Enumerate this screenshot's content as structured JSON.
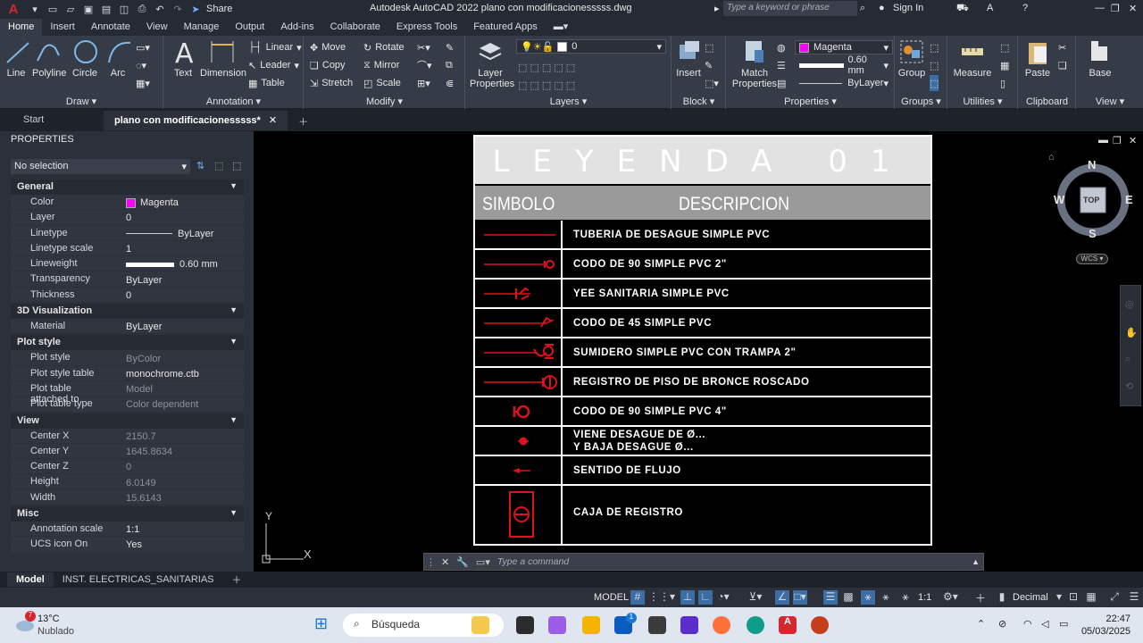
{
  "titlebar": {
    "title": "Autodesk AutoCAD 2022    plano con modificacionesssss.dwg",
    "share": "Share",
    "search_placeholder": "Type a keyword or phrase",
    "sign_in": "Sign In"
  },
  "ribbon_tabs": [
    "Home",
    "Insert",
    "Annotate",
    "View",
    "Manage",
    "Output",
    "Add-ins",
    "Collaborate",
    "Express Tools",
    "Featured Apps"
  ],
  "ribbon": {
    "draw": {
      "title": "Draw ▾",
      "line": "Line",
      "polyline": "Polyline",
      "circle": "Circle",
      "arc": "Arc"
    },
    "annotation": {
      "title": "Annotation ▾",
      "text": "Text",
      "dimension": "Dimension",
      "linear": "Linear",
      "leader": "Leader",
      "table": "Table"
    },
    "modify": {
      "title": "Modify ▾",
      "move": "Move",
      "rotate": "Rotate",
      "copy": "Copy",
      "mirror": "Mirror",
      "stretch": "Stretch",
      "scale": "Scale"
    },
    "layers": {
      "title": "Layers ▾",
      "layer_properties_1": "Layer",
      "layer_properties_2": "Properties",
      "layer_value": "0"
    },
    "block": {
      "title": "Block ▾",
      "insert": "Insert"
    },
    "properties": {
      "title": "Properties ▾",
      "match_1": "Match",
      "match_2": "Properties",
      "color": "Magenta",
      "lineweight": "0.60 mm",
      "linetype": "ByLayer"
    },
    "groups": {
      "title": "Groups ▾",
      "group": "Group"
    },
    "utilities": {
      "title": "Utilities ▾",
      "measure": "Measure"
    },
    "clipboard": {
      "title": "Clipboard",
      "paste": "Paste"
    },
    "view": {
      "title": "View ▾",
      "base": "Base"
    }
  },
  "doc_tabs": {
    "start": "Start",
    "active": "plano con modificacionesssss*"
  },
  "properties_palette": {
    "header": "PROPERTIES",
    "selection": "No selection",
    "sections": {
      "general": "General",
      "viz": "3D Visualization",
      "plot": "Plot style",
      "view": "View",
      "misc": "Misc"
    },
    "general": [
      {
        "k": "Color",
        "v": "Magenta"
      },
      {
        "k": "Layer",
        "v": "0"
      },
      {
        "k": "Linetype",
        "v": "ByLayer"
      },
      {
        "k": "Linetype scale",
        "v": "1"
      },
      {
        "k": "Lineweight",
        "v": "0.60 mm"
      },
      {
        "k": "Transparency",
        "v": "ByLayer"
      },
      {
        "k": "Thickness",
        "v": "0"
      }
    ],
    "viz": [
      {
        "k": "Material",
        "v": "ByLayer"
      }
    ],
    "plot": [
      {
        "k": "Plot style",
        "v": "ByColor"
      },
      {
        "k": "Plot style table",
        "v": "monochrome.ctb"
      },
      {
        "k": "Plot table attached to",
        "v": "Model"
      },
      {
        "k": "Plot table type",
        "v": "Color dependent"
      }
    ],
    "view": [
      {
        "k": "Center X",
        "v": "2150.7"
      },
      {
        "k": "Center Y",
        "v": "1645.8634"
      },
      {
        "k": "Center Z",
        "v": "0"
      },
      {
        "k": "Height",
        "v": "6.0149"
      },
      {
        "k": "Width",
        "v": "15.6143"
      }
    ],
    "misc": [
      {
        "k": "Annotation scale",
        "v": "1:1"
      },
      {
        "k": "UCS icon On",
        "v": "Yes"
      }
    ]
  },
  "legend": {
    "title": "LEYENDA 01",
    "col_symbol": "SIMBOLO",
    "col_desc": "DESCRIPCION",
    "rows": [
      "TUBERIA DE DESAGUE SIMPLE PVC",
      "CODO DE 90 SIMPLE PVC 2\"",
      "YEE SANITARIA SIMPLE PVC",
      "CODO DE 45 SIMPLE PVC",
      "SUMIDERO SIMPLE PVC CON TRAMPA 2\"",
      "REGISTRO DE PISO DE BRONCE ROSCADO",
      "CODO DE 90 SIMPLE PVC 4\"",
      "VIENE DESAGUE DE Ø...",
      "Y BAJA DESAGUE Ø...",
      "SENTIDO DE FLUJO",
      "CAJA DE REGISTRO"
    ]
  },
  "navcube": {
    "n": "N",
    "s": "S",
    "e": "E",
    "w": "W",
    "top": "TOP",
    "wcs": "WCS"
  },
  "ucs": {
    "x": "X",
    "y": "Y"
  },
  "command": {
    "placeholder": "Type a command"
  },
  "layout_tabs": [
    "Model",
    "INST. ELECTRICAS_SANITARIAS"
  ],
  "statusbar": {
    "model": "MODEL",
    "scale": "1:1",
    "units": "Decimal"
  },
  "taskbar": {
    "temp": "13°C",
    "weather": "Nublado",
    "weather_badge": "7",
    "search": "Búsqueda",
    "time": "22:47",
    "date": "05/03/2025",
    "store_badge": "1"
  },
  "colors": {
    "accent_red": "#e0101c",
    "magenta": "#ff00ff",
    "bg_dark": "#1e222b",
    "panel": "#353b47"
  }
}
